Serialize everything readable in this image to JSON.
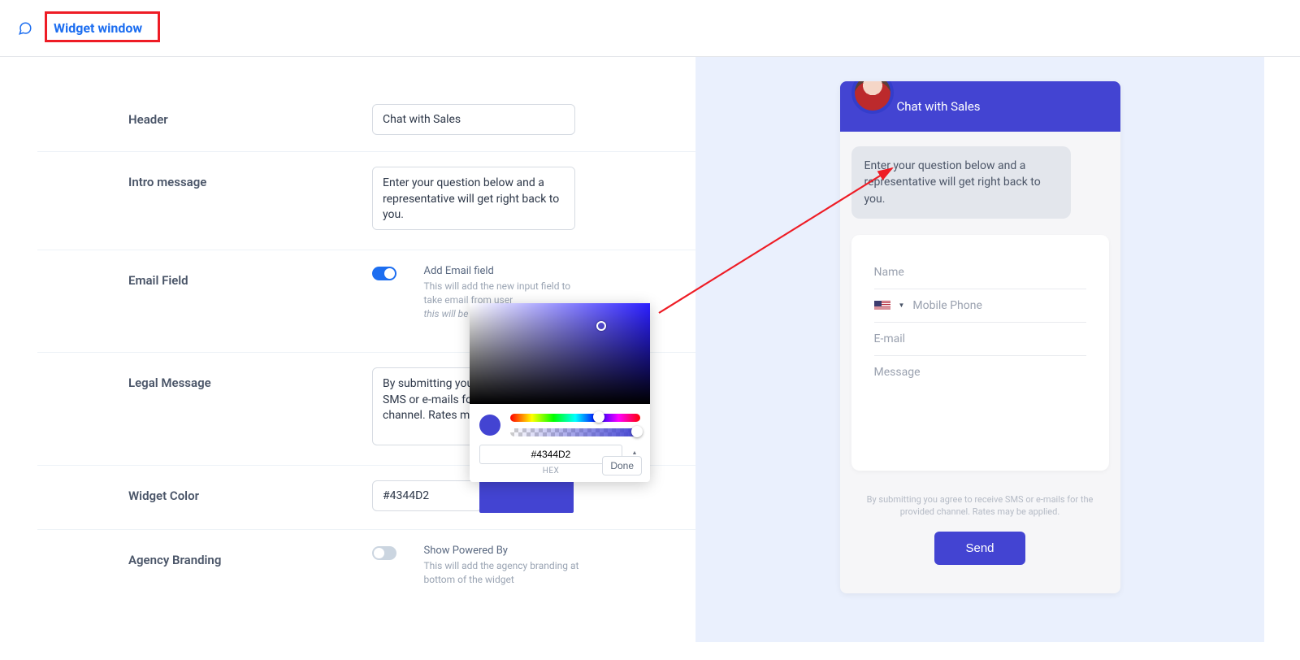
{
  "tab": {
    "label": "Widget window"
  },
  "settings": {
    "header": {
      "label": "Header",
      "value": "Chat with Sales"
    },
    "intro": {
      "label": "Intro message",
      "value": "Enter your question below and a representative will get right back to you."
    },
    "email": {
      "label": "Email Field",
      "title": "Add Email field",
      "desc": "This will add the new input field to take email from user",
      "note": "this will be"
    },
    "legal": {
      "label": "Legal Message",
      "value": "By submitting you agree to receive SMS or e-mails for the provided channel. Rates may be applied."
    },
    "widget_color": {
      "label": "Widget Color",
      "hex": "#4344D2"
    },
    "agency": {
      "label": "Agency Branding",
      "title": "Show Powered By",
      "desc": "This will add the agency branding at bottom of the widget"
    }
  },
  "picker": {
    "hex": "#4344D2",
    "hex_label": "HEX",
    "done": "Done"
  },
  "preview": {
    "header": "Chat with Sales",
    "intro": "Enter your question below and a representative will get right back to you.",
    "fields": {
      "name": "Name",
      "phone": "Mobile Phone",
      "email": "E-mail",
      "message": "Message"
    },
    "legal": "By submitting you agree to receive SMS or e-mails for the provided channel. Rates may be applied.",
    "send": "Send"
  }
}
